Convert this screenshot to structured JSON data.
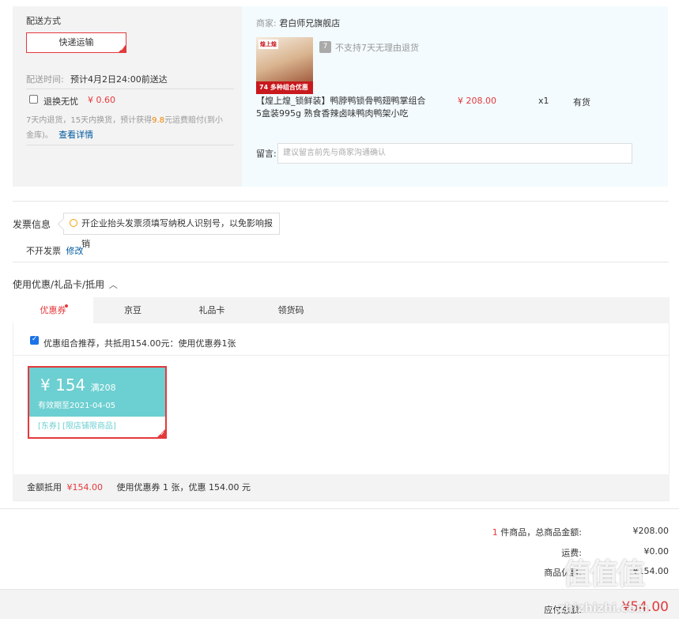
{
  "delivery": {
    "title": "配送方式",
    "method": "快递运输",
    "time_label": "配送时间:",
    "time_value": "预计4月2日24:00前送达",
    "return_free_label": "退换无忧",
    "return_free_price": "¥ 0.60",
    "return_desc_1": "7天内退货，15天内换货，预计获得",
    "return_desc_amount": "9.8",
    "return_desc_2": "元运费赔付(到小",
    "return_desc_3": "金库)。",
    "return_detail_link": "查看详情"
  },
  "shop": {
    "merchant_label": "商家:",
    "merchant_name": "君白师兄旗舰店",
    "no_return_icon": "7",
    "no_return_text": "不支持7天无理由退货",
    "product_logo": "煌上煌",
    "product_banner": "74 多种组合优惠",
    "product_title_1": "【煌上煌_锁鲜装】鸭脖鸭锁骨鸭翅鸭掌组合",
    "product_title_2": "5盒装995g 熟食香辣卤味鸭肉鸭架小吃",
    "price": "¥ 208.00",
    "quantity": "x1",
    "stock": "有货",
    "message_label": "留言:",
    "message_placeholder": "建议留言前先与商家沟通确认"
  },
  "invoice": {
    "title": "发票信息",
    "tip": "开企业抬头发票须填写纳税人识别号，以免影响报销",
    "status": "不开发票",
    "modify_link": "修改"
  },
  "discount": {
    "title": "使用优惠/礼品卡/抵用",
    "tabs": [
      {
        "label": "优惠券"
      },
      {
        "label": "京豆"
      },
      {
        "label": "礼品卡"
      },
      {
        "label": "领货码"
      }
    ],
    "recommend_text": "优惠组合推荐，共抵用154.00元：使用优惠券1张",
    "coupon": {
      "currency": "¥",
      "amount": "154",
      "condition": "满208",
      "expiry": "有效期至2021-04-05",
      "tag_1": "[东券]",
      "tag_2": "[限店铺限商品]"
    },
    "summary_label": "金额抵用",
    "summary_amount": "¥154.00",
    "summary_detail": "使用优惠券 1 张，优惠 154.00 元"
  },
  "totals": {
    "count": "1",
    "count_label": "件商品，总商品金额:",
    "goods_amount": "¥208.00",
    "shipping_label": "运费:",
    "shipping_amount": "¥0.00",
    "discount_label": "商品优惠:",
    "discount_amount": "-¥154.00",
    "payable_label": "应付总额:",
    "payable_amount": "¥54.00"
  },
  "watermark": {
    "big": "值值值",
    "site": "zhizhizhi.com"
  },
  "colors": {
    "accent_red": "#e4393c",
    "coupon_teal": "#6ccfd1",
    "link_blue": "#005aa0",
    "shop_bg": "#f3fbfe"
  }
}
